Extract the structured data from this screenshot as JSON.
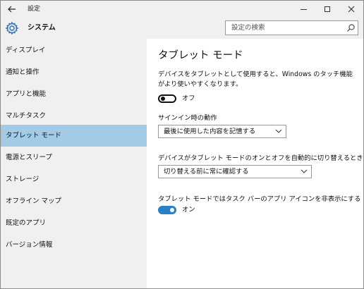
{
  "titlebar": {
    "back_icon": "back-arrow-icon",
    "title": "設定",
    "minimize_icon": "minimize-icon",
    "maximize_icon": "maximize-icon",
    "close_icon": "close-icon"
  },
  "header": {
    "icon": "gear-icon",
    "title": "システム",
    "search": {
      "placeholder": "設定の検索",
      "icon": "search-icon"
    }
  },
  "sidebar": {
    "items": [
      {
        "label": "ディスプレイ",
        "selected": false
      },
      {
        "label": "通知と操作",
        "selected": false
      },
      {
        "label": "アプリと機能",
        "selected": false
      },
      {
        "label": "マルチタスク",
        "selected": false
      },
      {
        "label": "タブレット モード",
        "selected": true
      },
      {
        "label": "電源とスリープ",
        "selected": false
      },
      {
        "label": "ストレージ",
        "selected": false
      },
      {
        "label": "オフライン マップ",
        "selected": false
      },
      {
        "label": "既定のアプリ",
        "selected": false
      },
      {
        "label": "バージョン情報",
        "selected": false
      }
    ],
    "selected_color": "#a3cbe6"
  },
  "main": {
    "title": "タブレット モード",
    "tablet_mode_description": "デバイスをタブレットとして使用すると、Windows のタッチ機能がより使いやすくなります。",
    "tablet_mode_toggle": {
      "state": "off",
      "label": "オフ"
    },
    "signin_label": "サインイン時の動作",
    "signin_dropdown": {
      "value": "最後に使用した内容を記憶する",
      "icon": "chevron-down-icon"
    },
    "auto_switch_label": "デバイスがタブレット モードのオンとオフを自動的に切り替えるとき",
    "auto_switch_dropdown": {
      "value": "切り替える前に常に確認する",
      "icon": "chevron-down-icon"
    },
    "hide_icons_label": "タブレット モードではタスク バーのアプリ アイコンを非表示にする",
    "hide_icons_toggle": {
      "state": "on",
      "label": "オン"
    },
    "accent_color": "#2a7fc9"
  }
}
